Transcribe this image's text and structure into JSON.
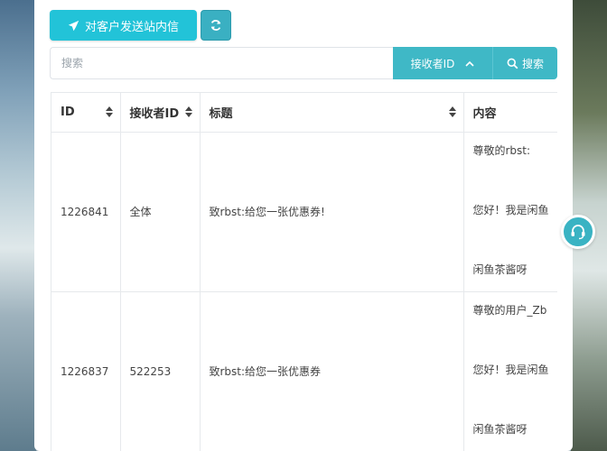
{
  "toolbar": {
    "send_label": "对客户发送站内信"
  },
  "search": {
    "placeholder": "搜索",
    "field_label": "接收者ID",
    "button_label": "搜索"
  },
  "table": {
    "headers": [
      "ID",
      "接收者ID",
      "标题",
      "内容"
    ],
    "rows": [
      {
        "id": "1226841",
        "recipient": "全体",
        "title": "致rbst:给您一张优惠券!",
        "content": [
          "尊敬的rbst:",
          "您好！我是闲鱼",
          "闲鱼茶酱呀"
        ]
      },
      {
        "id": "1226837",
        "recipient": "522253",
        "title": "致rbst:给您一张优惠券",
        "content": [
          "尊敬的用户_Zb",
          "您好！我是闲鱼",
          "闲鱼茶酱呀"
        ]
      }
    ]
  },
  "colors": {
    "accent": "#22c3d8",
    "search_bar": "#3fb8c6"
  }
}
